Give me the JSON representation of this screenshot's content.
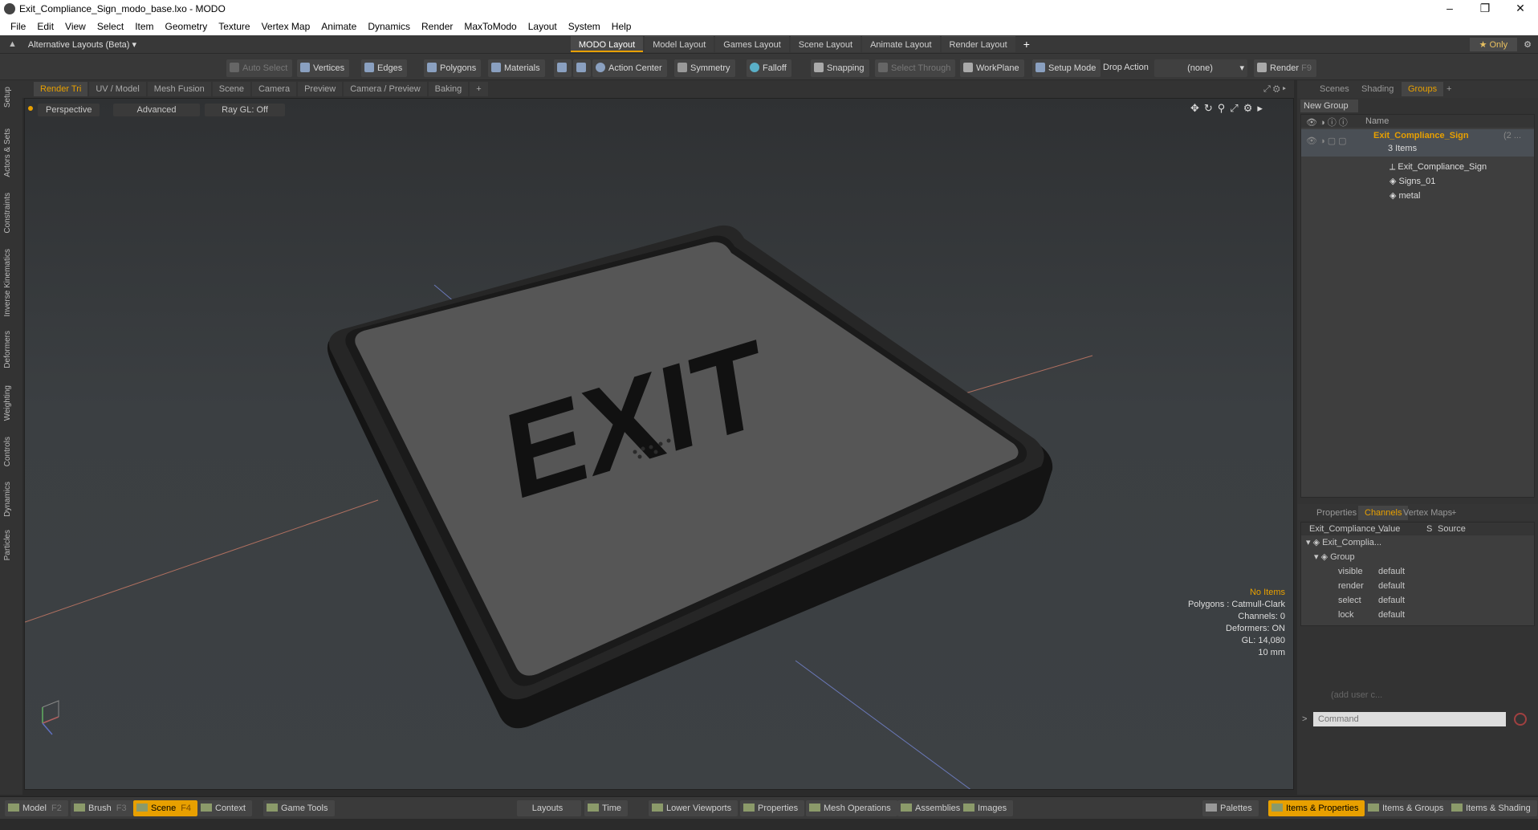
{
  "title": "Exit_Compliance_Sign_modo_base.lxo - MODO",
  "window_controls": {
    "minimize": "–",
    "restore": "❐",
    "close": "✕"
  },
  "menu": [
    "File",
    "Edit",
    "View",
    "Select",
    "Item",
    "Geometry",
    "Texture",
    "Vertex Map",
    "Animate",
    "Dynamics",
    "Render",
    "MaxToModo",
    "Layout",
    "System",
    "Help"
  ],
  "layout_selector": "Alternative Layouts (Beta) ▾",
  "layout_tabs": [
    "MODO Layout",
    "Model Layout",
    "Games Layout",
    "Scene Layout",
    "Animate Layout",
    "Render Layout"
  ],
  "layout_add": "+",
  "only_label": "★ Only",
  "toolbar": {
    "auto_select": "Auto Select",
    "vertices": "Vertices",
    "edges": "Edges",
    "polygons": "Polygons",
    "materials": "Materials",
    "action_center": "Action Center",
    "symmetry": "Symmetry",
    "falloff": "Falloff",
    "snapping": "Snapping",
    "select_through": "Select Through",
    "workplane": "WorkPlane",
    "setup_mode": "Setup Mode",
    "drop_action": "Drop Action",
    "drop_value": "(none)",
    "render": "Render",
    "render_key": "F9"
  },
  "left_tabs": [
    "Setup",
    "Actors & Sets",
    "Constraints",
    "Inverse Kinematics",
    "Deformers",
    "Weighting",
    "Controls",
    "Dynamics",
    "Particles"
  ],
  "viewport_tabs": [
    "Render Tri",
    "UV / Model",
    "Mesh Fusion",
    "Scene",
    "Camera",
    "Preview",
    "Camera / Preview",
    "Baking",
    "+"
  ],
  "viewport_opts": {
    "view": "Perspective",
    "mode": "Advanced",
    "raygl": "Ray GL: Off"
  },
  "sign_text": "EXIT",
  "stats": {
    "items": "No Items",
    "polygons": "Polygons : Catmull-Clark",
    "channels": "Channels: 0",
    "deformers": "Deformers: ON",
    "gl": "GL: 14,080",
    "scale": "10 mm"
  },
  "right_tabs_top": [
    "Scenes",
    "Shading",
    "Groups",
    "+"
  ],
  "new_group": "New Group",
  "groups_header": "Name",
  "groups_tree": {
    "root": "Exit_Compliance_Sign",
    "root_suffix": "(2 ...",
    "count": "3 Items",
    "children": [
      "Exit_Compliance_Sign",
      "Signs_01",
      "metal"
    ]
  },
  "right_tabs_bottom": [
    "Properties",
    "Channels",
    "Vertex Maps",
    "+"
  ],
  "channels_headers": {
    "name": "Exit_Compliance_...",
    "value": "Value",
    "s": "S",
    "source": "Source"
  },
  "channels_tree": {
    "item": "Exit_Complia...",
    "group": "Group",
    "rows": [
      {
        "name": "visible",
        "value": "default"
      },
      {
        "name": "render",
        "value": "default"
      },
      {
        "name": "select",
        "value": "default"
      },
      {
        "name": "lock",
        "value": "default"
      }
    ],
    "add_user": "(add user c..."
  },
  "command_placeholder": "Command",
  "bottom_left": [
    {
      "label": "Model",
      "key": "F2"
    },
    {
      "label": "Brush",
      "key": "F3"
    },
    {
      "label": "Scene",
      "key": "F4"
    },
    {
      "label": "Context",
      "key": ""
    },
    {
      "label": "Game Tools",
      "key": ""
    }
  ],
  "bottom_mid": [
    "Layouts",
    "Time",
    "Lower Viewports",
    "Properties",
    "Mesh Operations",
    "Assemblies",
    "Images"
  ],
  "bottom_right": [
    "Palettes",
    "Items & Properties",
    "Items & Groups",
    "Items & Shading"
  ],
  "colors": {
    "accent": "#e8a000",
    "sign": "#5a5a5a",
    "frame": "#1e1e1e"
  }
}
